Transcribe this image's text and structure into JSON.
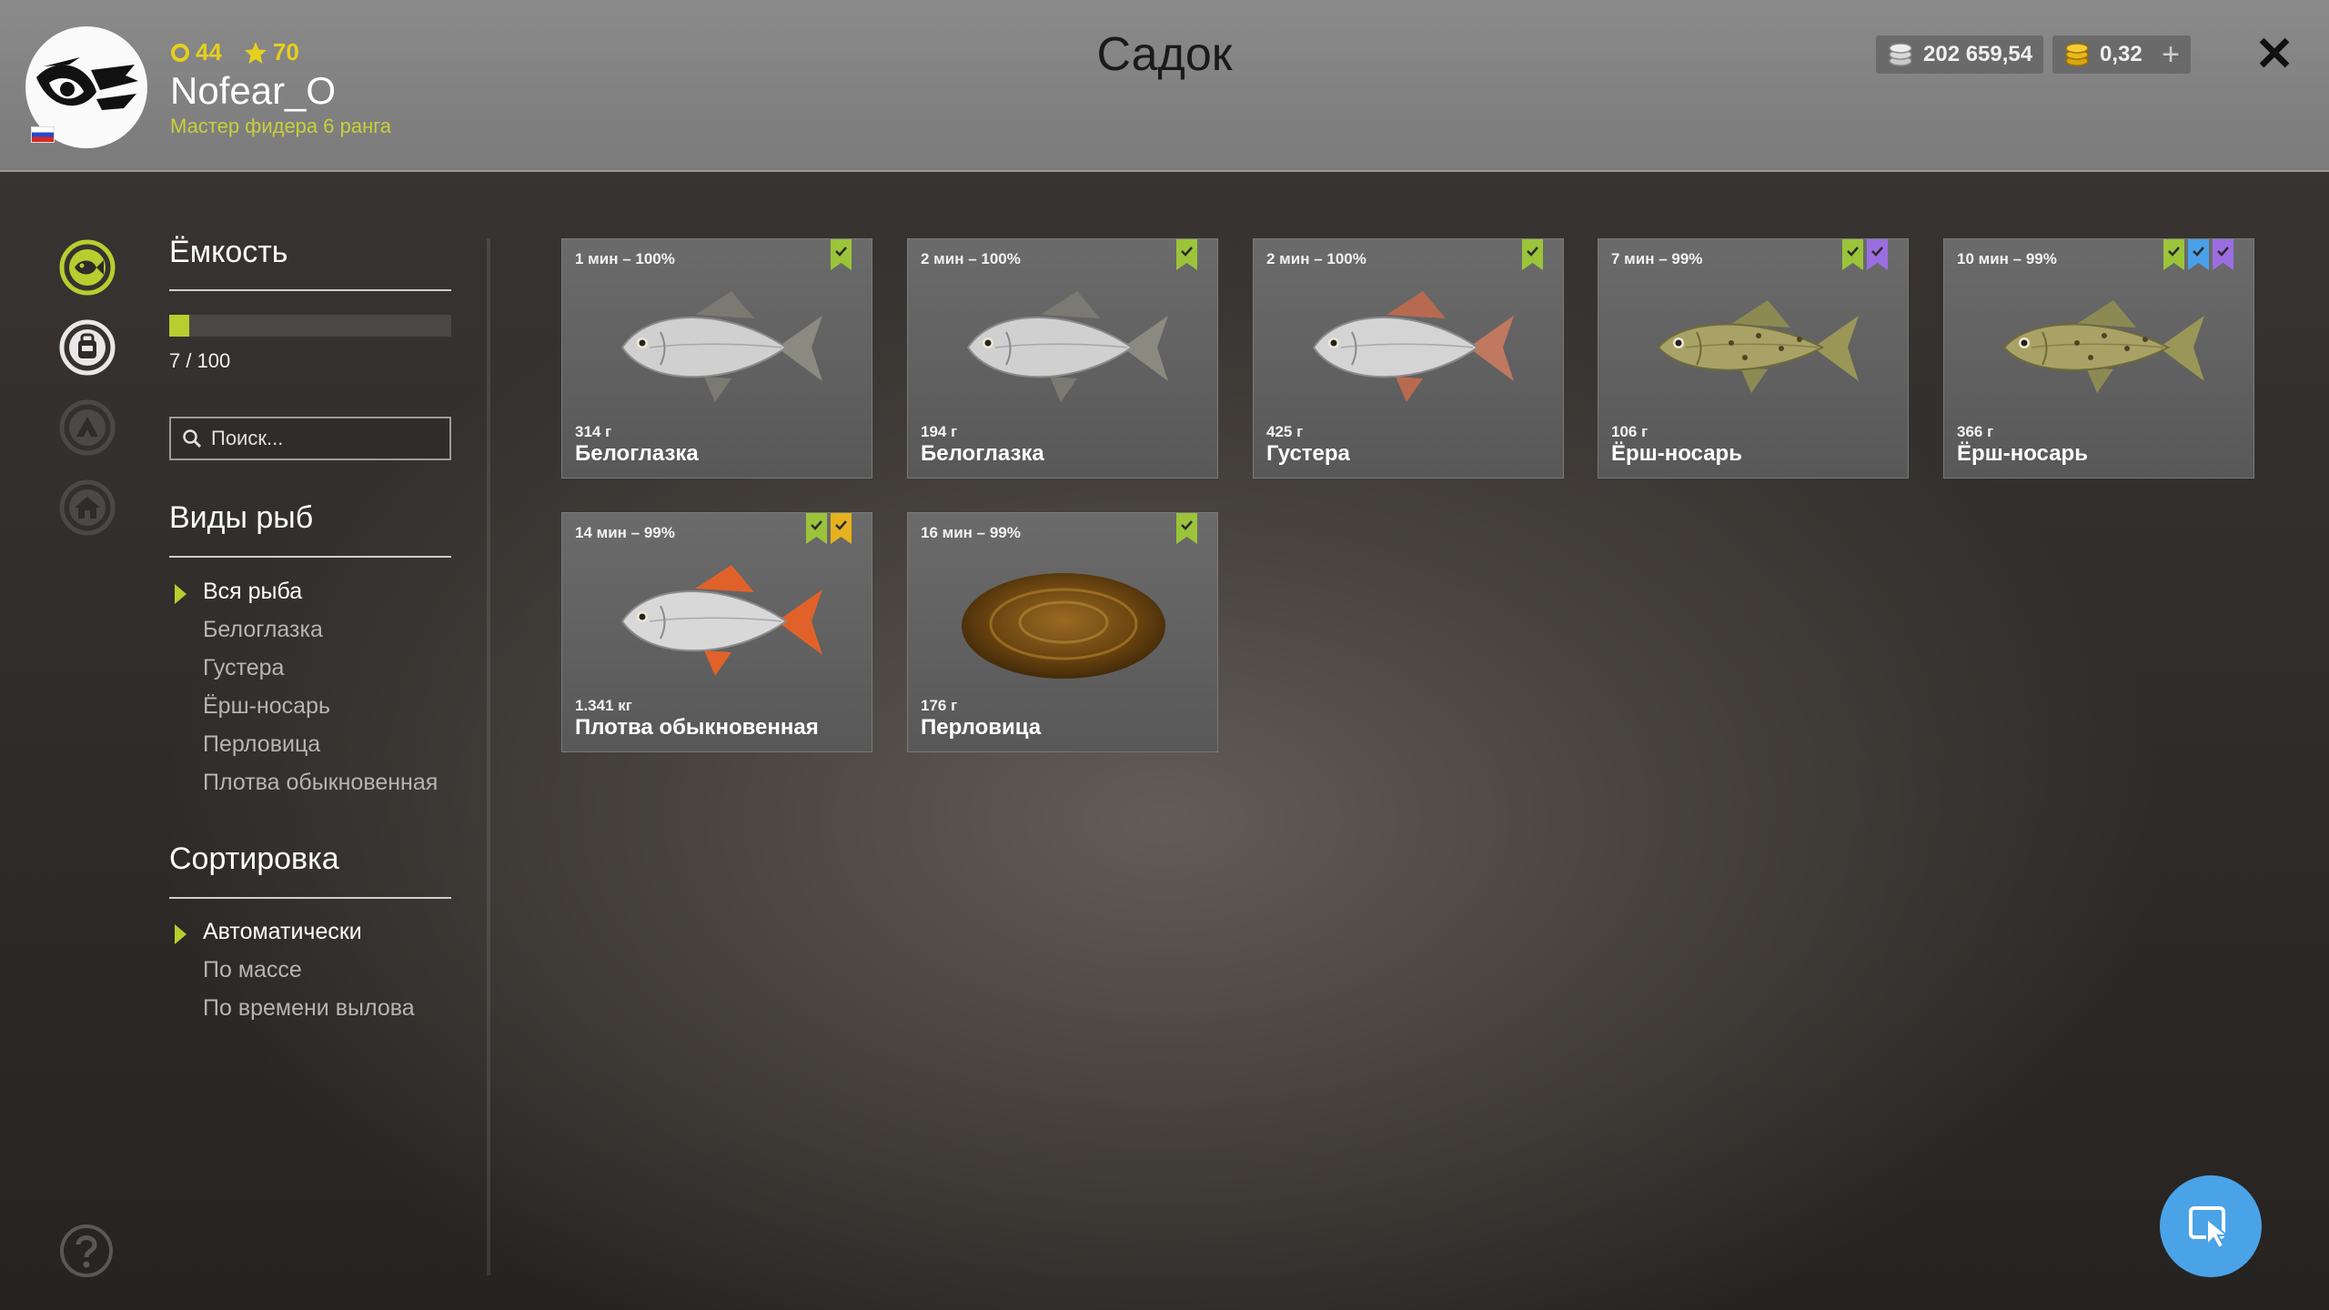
{
  "header": {
    "title": "Садок",
    "player": {
      "name": "Nofear_O",
      "rank": "Мастер фидера 6 ранга",
      "level": "44",
      "stars": "70"
    },
    "currency": {
      "silver": "202 659,54",
      "gold": "0,32"
    }
  },
  "rail": {
    "icons": [
      "keepnet-fish-icon",
      "backpack-icon",
      "tent-icon",
      "home-icon"
    ]
  },
  "filters": {
    "capacity": {
      "title": "Ёмкость",
      "text": "7 / 100",
      "fill": 0.07
    },
    "search": {
      "placeholder": "Поиск..."
    },
    "species": {
      "title": "Виды рыб",
      "items": [
        "Вся рыба",
        "Белоглазка",
        "Густера",
        "Ёрш-носарь",
        "Перловица",
        "Плотва обыкновенная"
      ],
      "selected": 0
    },
    "sort": {
      "title": "Сортировка",
      "items": [
        "Автоматически",
        "По массе",
        "По времени вылова"
      ],
      "selected": 0
    }
  },
  "catches": [
    {
      "time": "1 мин – 100%",
      "weight": "314 г",
      "name": "Белоглазка",
      "badges": [
        "green"
      ],
      "kind": "bream"
    },
    {
      "time": "2 мин – 100%",
      "weight": "194 г",
      "name": "Белоглазка",
      "badges": [
        "green"
      ],
      "kind": "bream"
    },
    {
      "time": "2 мин – 100%",
      "weight": "425 г",
      "name": "Густера",
      "badges": [
        "green"
      ],
      "kind": "silverbream"
    },
    {
      "time": "7 мин – 99%",
      "weight": "106 г",
      "name": "Ёрш-носарь",
      "badges": [
        "green",
        "purple"
      ],
      "kind": "ruffe"
    },
    {
      "time": "10 мин – 99%",
      "weight": "366 г",
      "name": "Ёрш-носарь",
      "badges": [
        "green",
        "blue",
        "purple"
      ],
      "kind": "ruffe"
    },
    {
      "time": "14 мин – 99%",
      "weight": "1.341 кг",
      "name": "Плотва обыкновенная",
      "badges": [
        "green",
        "gold"
      ],
      "kind": "roach"
    },
    {
      "time": "16 мин – 99%",
      "weight": "176 г",
      "name": "Перловица",
      "badges": [
        "green"
      ],
      "kind": "mussel"
    }
  ],
  "colors": {
    "accent": "#b8cd2f",
    "badge_green": "#9bc43a",
    "badge_blue": "#4aa0e6",
    "badge_purple": "#9b6ee0",
    "badge_gold": "#e6b21e",
    "cursor_button": "#4aa3e6"
  },
  "icons": {
    "close": "close-icon",
    "help": "help-icon",
    "cursor": "cursor-icon",
    "plus": "plus-icon",
    "search": "search-icon"
  }
}
